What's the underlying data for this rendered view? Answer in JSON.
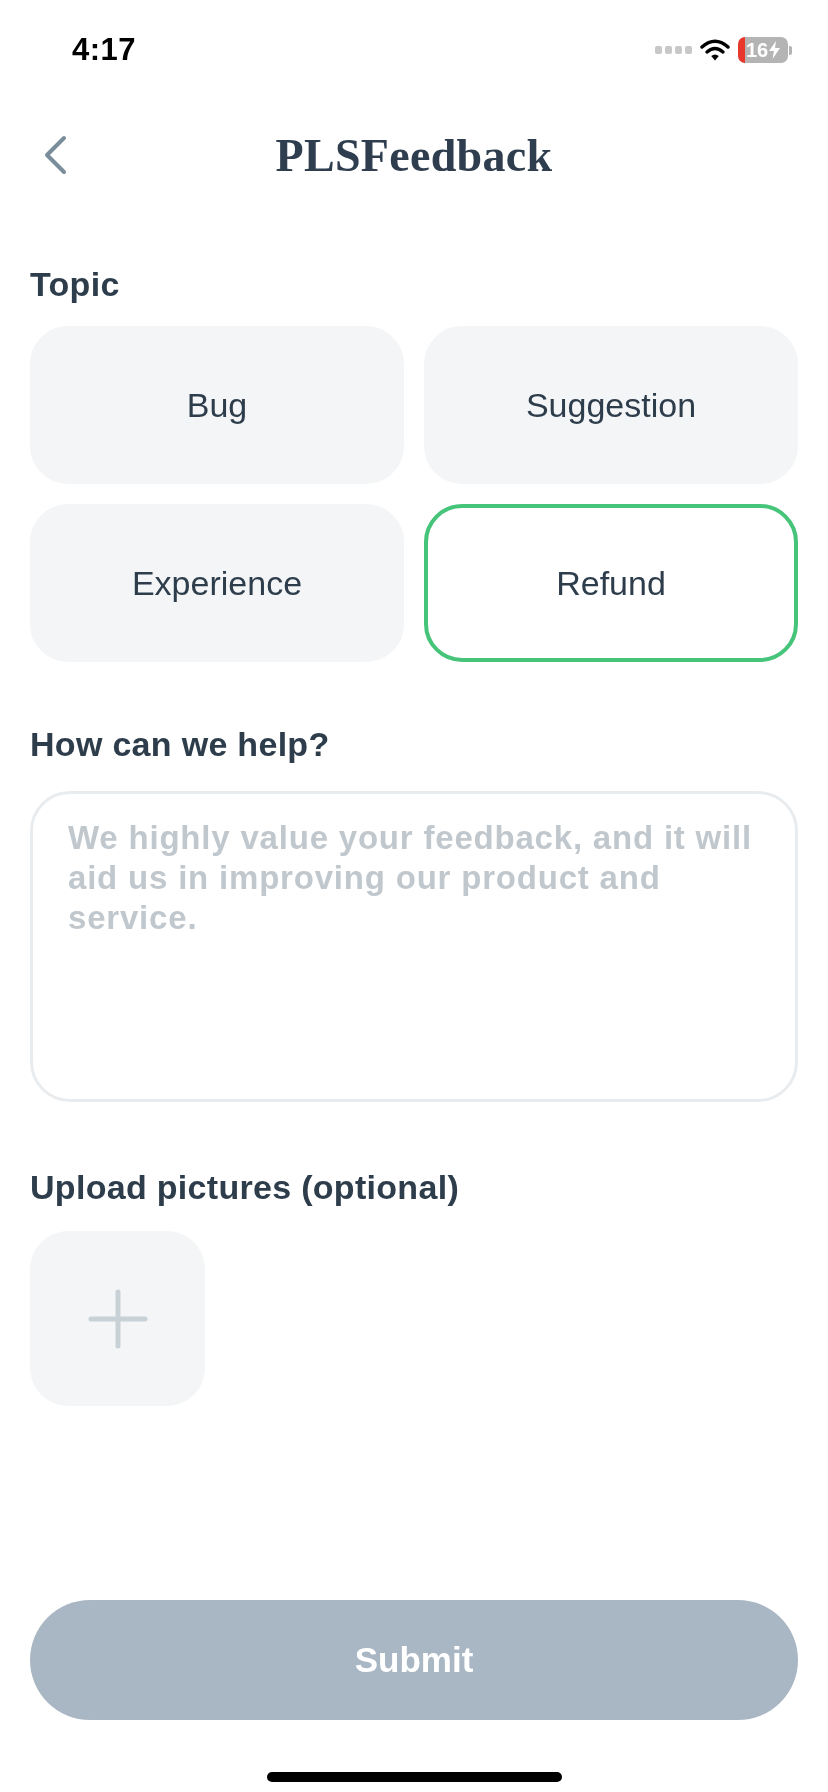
{
  "status_bar": {
    "time": "4:17",
    "battery_text": "16"
  },
  "header": {
    "title": "PLSFeedback"
  },
  "topic": {
    "label": "Topic",
    "options": [
      {
        "label": "Bug",
        "selected": false
      },
      {
        "label": "Suggestion",
        "selected": false
      },
      {
        "label": "Experience",
        "selected": false
      },
      {
        "label": "Refund",
        "selected": true
      }
    ]
  },
  "message": {
    "label": "How can we help?",
    "placeholder": "We highly value your feedback, and it will aid us in improving our product and service."
  },
  "upload": {
    "label": "Upload pictures (optional)"
  },
  "submit": {
    "label": "Submit",
    "disabled": true
  }
}
